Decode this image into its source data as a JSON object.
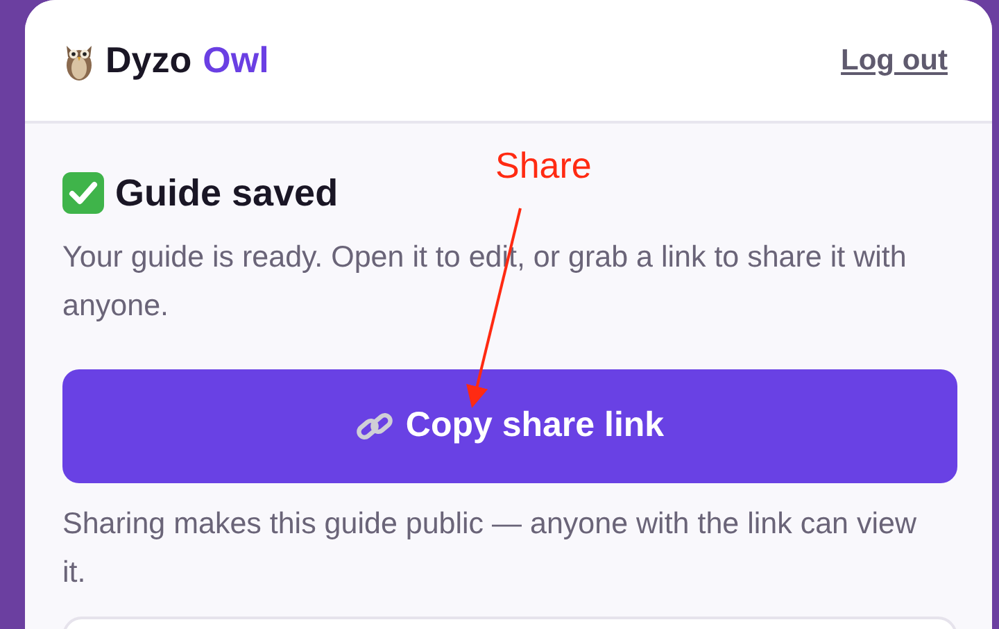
{
  "header": {
    "brand_name": "Dyzo",
    "brand_accent": "Owl",
    "logout_link": "Log out"
  },
  "content": {
    "title": "Guide saved",
    "description": "Your guide is ready. Open it to edit, or grab a link to share it with anyone.",
    "share_button": "Copy share link",
    "note": "Sharing makes this guide public — anyone with the link can view it."
  },
  "annotation": {
    "label": "Share"
  }
}
